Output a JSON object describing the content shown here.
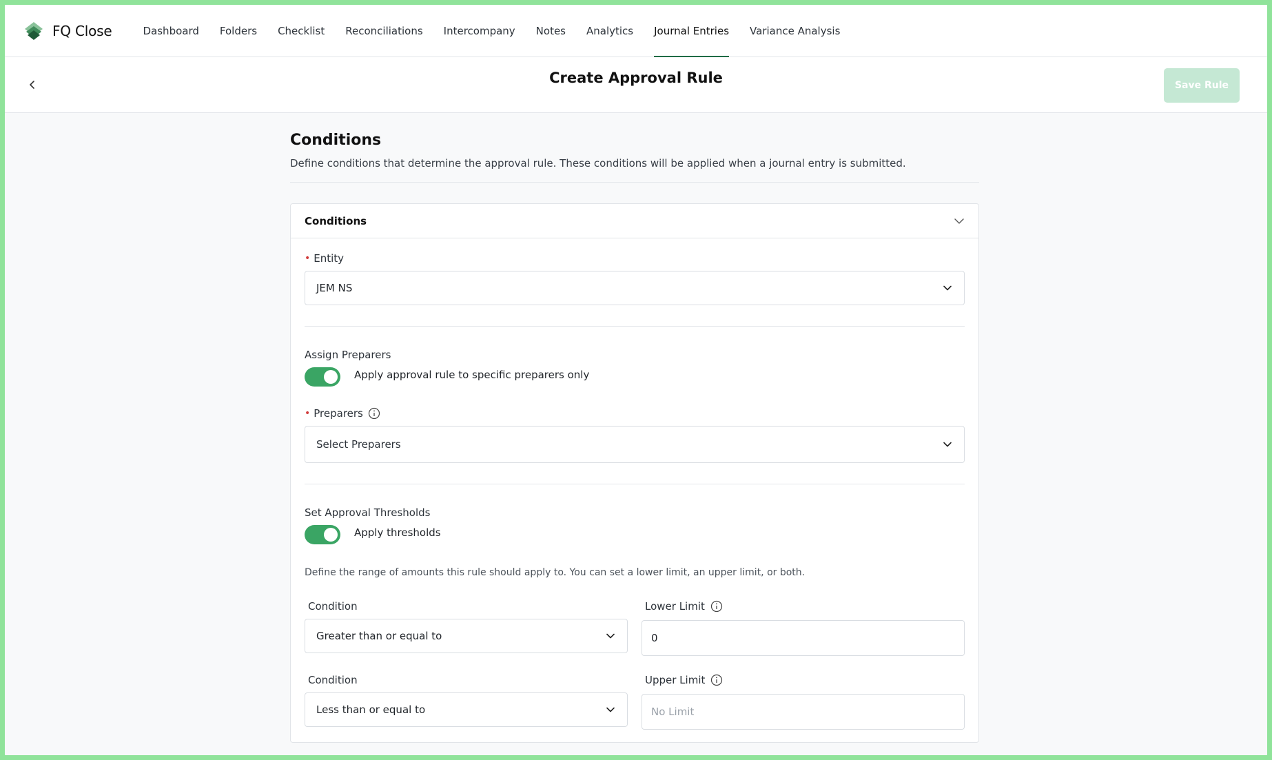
{
  "app": {
    "name": "FQ Close"
  },
  "nav": {
    "tabs": [
      {
        "label": "Dashboard"
      },
      {
        "label": "Folders"
      },
      {
        "label": "Checklist"
      },
      {
        "label": "Reconciliations"
      },
      {
        "label": "Intercompany"
      },
      {
        "label": "Notes"
      },
      {
        "label": "Analytics"
      },
      {
        "label": "Journal Entries",
        "active": true
      },
      {
        "label": "Variance Analysis"
      }
    ]
  },
  "header": {
    "title": "Create Approval Rule",
    "save_label": "Save Rule"
  },
  "conditions": {
    "title": "Conditions",
    "description": "Define conditions that determine the approval rule. These conditions will be applied when a journal entry is submitted.",
    "card_label": "Conditions",
    "entity": {
      "label": "Entity",
      "value": "JEM NS"
    },
    "assign_preparers": {
      "title": "Assign Preparers",
      "toggle_label": "Apply approval rule to specific preparers only",
      "enabled": true
    },
    "preparers": {
      "label": "Preparers",
      "placeholder": "Select Preparers"
    },
    "thresholds": {
      "title": "Set Approval Thresholds",
      "toggle_label": "Apply thresholds",
      "enabled": true,
      "help": "Define the range of amounts this rule should apply to. You can set a lower limit, an upper limit, or both.",
      "lower_condition": {
        "label": "Condition",
        "value": "Greater than or equal to"
      },
      "lower_limit": {
        "label": "Lower Limit",
        "value": "0"
      },
      "upper_condition": {
        "label": "Condition",
        "value": "Less than or equal to"
      },
      "upper_limit": {
        "label": "Upper Limit",
        "placeholder": "No Limit"
      }
    }
  },
  "colors": {
    "accent": "#3aa564",
    "active_tab_underline": "#1f6b45",
    "save_disabled": "#c5e8d4",
    "frame": "#90e39a"
  }
}
